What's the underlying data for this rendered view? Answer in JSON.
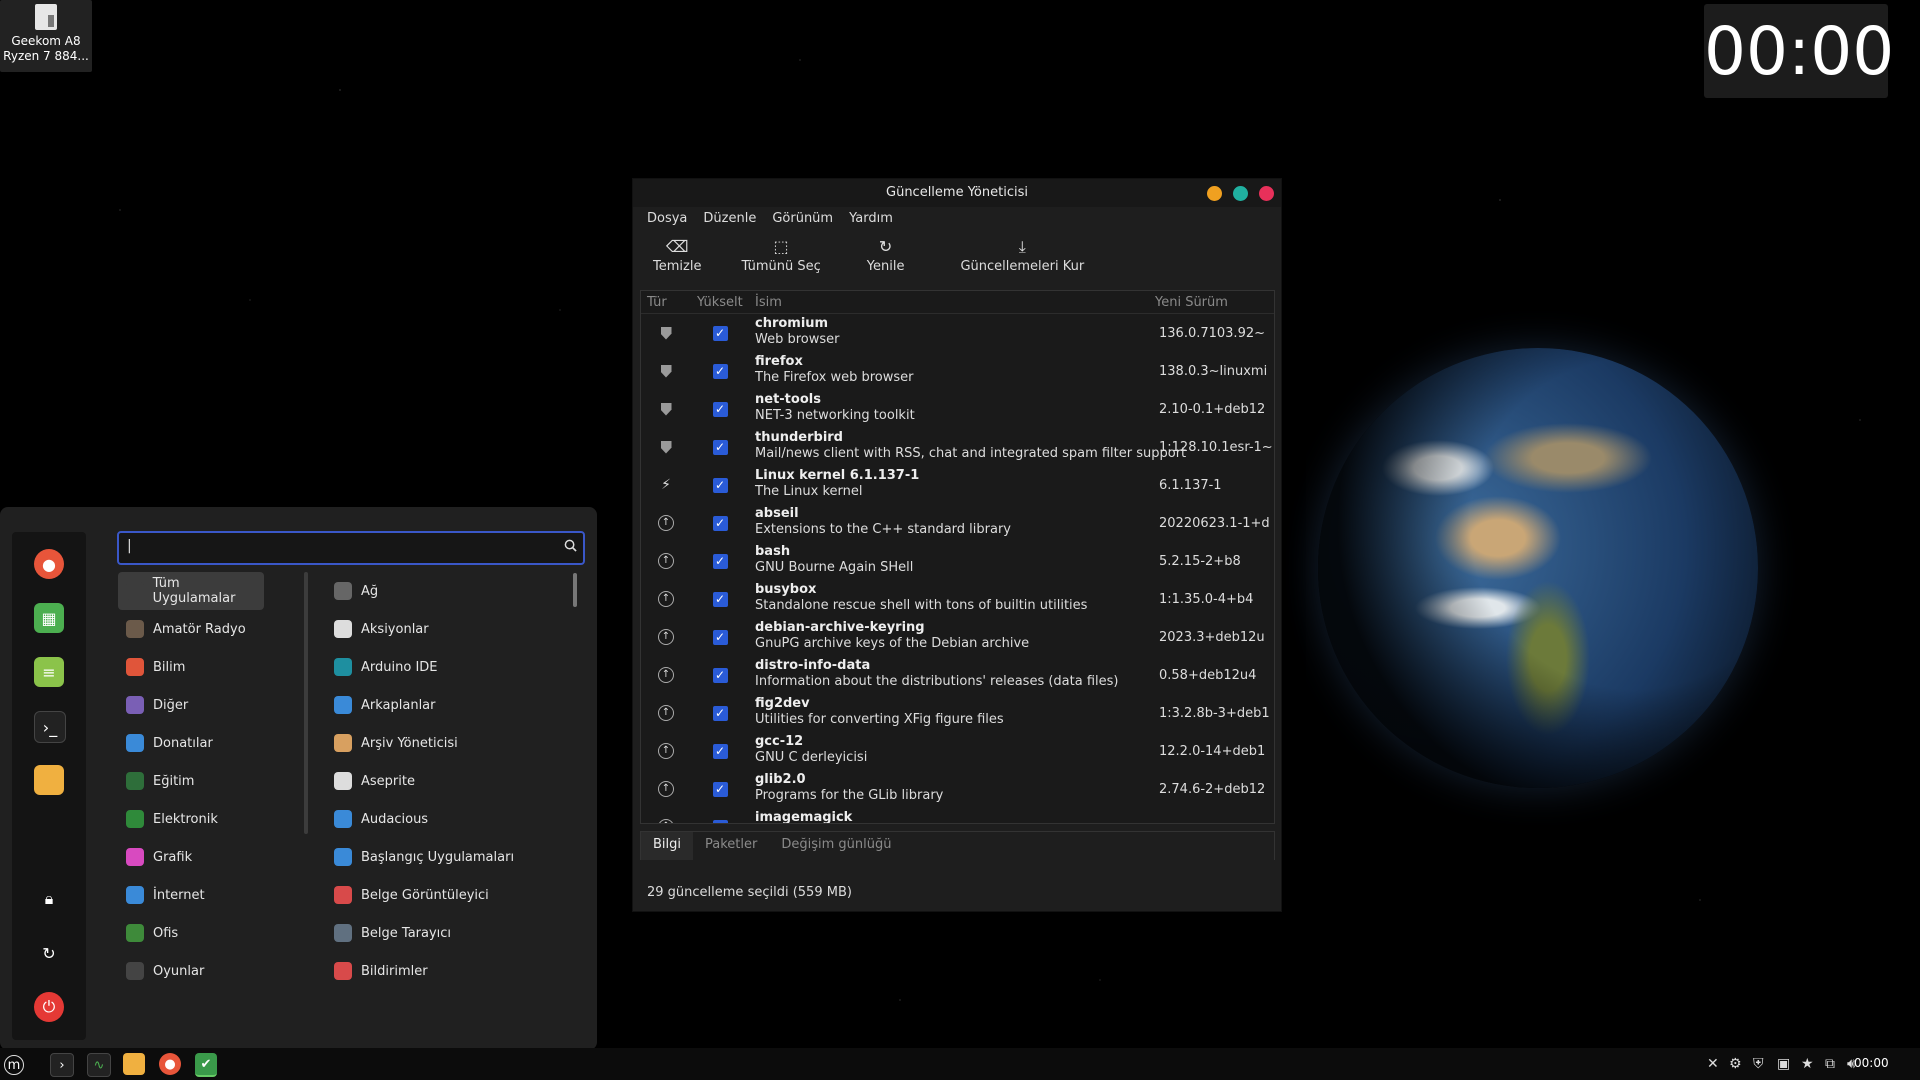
{
  "desktop": {
    "icon_label_line1": "Geekom A8",
    "icon_label_line2": "Ryzen 7 884...",
    "clock": "00:00"
  },
  "window": {
    "title": "Güncelleme Yöneticisi",
    "menu": [
      "Dosya",
      "Düzenle",
      "Görünüm",
      "Yardım"
    ],
    "toolbar": {
      "clear": "Temizle",
      "select_all": "Tümünü Seç",
      "refresh": "Yenile",
      "install": "Güncellemeleri Kur"
    },
    "columns": {
      "type": "Tür",
      "upgrade": "Yükselt",
      "name": "İsim",
      "new_version": "Yeni Sürüm"
    },
    "updates": [
      {
        "type": "security",
        "name": "chromium",
        "desc": "Web browser",
        "version": "136.0.7103.92~"
      },
      {
        "type": "security",
        "name": "firefox",
        "desc": "The Firefox web browser",
        "version": "138.0.3~linuxmi"
      },
      {
        "type": "security",
        "name": "net-tools",
        "desc": "NET-3 networking toolkit",
        "version": "2.10-0.1+deb12"
      },
      {
        "type": "security",
        "name": "thunderbird",
        "desc": "Mail/news client with RSS, chat and integrated spam filter support",
        "version": "1:128.10.1esr-1~"
      },
      {
        "type": "kernel",
        "name": "Linux kernel 6.1.137-1",
        "desc": "The Linux kernel",
        "version": "6.1.137-1"
      },
      {
        "type": "update",
        "name": "abseil",
        "desc": "Extensions to the C++ standard library",
        "version": "20220623.1-1+d"
      },
      {
        "type": "update",
        "name": "bash",
        "desc": "GNU Bourne Again SHell",
        "version": "5.2.15-2+b8"
      },
      {
        "type": "update",
        "name": "busybox",
        "desc": "Standalone rescue shell with tons of builtin utilities",
        "version": "1:1.35.0-4+b4"
      },
      {
        "type": "update",
        "name": "debian-archive-keyring",
        "desc": "GnuPG archive keys of the Debian archive",
        "version": "2023.3+deb12u"
      },
      {
        "type": "update",
        "name": "distro-info-data",
        "desc": "Information about the distributions' releases (data files)",
        "version": "0.58+deb12u4"
      },
      {
        "type": "update",
        "name": "fig2dev",
        "desc": "Utilities for converting XFig figure files",
        "version": "1:3.2.8b-3+deb1"
      },
      {
        "type": "update",
        "name": "gcc-12",
        "desc": "GNU C derleyicisi",
        "version": "12.2.0-14+deb1"
      },
      {
        "type": "update",
        "name": "glib2.0",
        "desc": "Programs for the GLib library",
        "version": "2.74.6-2+deb12"
      },
      {
        "type": "update",
        "name": "imagemagick",
        "desc": "",
        "version": ""
      }
    ],
    "tabs": [
      "Bilgi",
      "Paketler",
      "Değişim günlüğü"
    ],
    "status": "29 güncelleme seçildi (559 MB)"
  },
  "app_menu": {
    "search_value": "|",
    "categories": [
      {
        "label": "Tüm Uygulamalar",
        "icon": "grid-icon",
        "color": "#3c3c3c"
      },
      {
        "label": "Amatör Radyo",
        "icon": "radio-icon",
        "color": "#6b5a4a"
      },
      {
        "label": "Bilim",
        "icon": "science-icon",
        "color": "#e0553a"
      },
      {
        "label": "Diğer",
        "icon": "grid-icon",
        "color": "#7a5fb5"
      },
      {
        "label": "Donatılar",
        "icon": "scissors-icon",
        "color": "#3a8ad8"
      },
      {
        "label": "Eğitim",
        "icon": "education-icon",
        "color": "#2e6e3a"
      },
      {
        "label": "Elektronik",
        "icon": "chip-icon",
        "color": "#2f8a3a"
      },
      {
        "label": "Grafik",
        "icon": "palette-icon",
        "color": "#d84ac0"
      },
      {
        "label": "İnternet",
        "icon": "cloud-icon",
        "color": "#3a8ad8"
      },
      {
        "label": "Ofis",
        "icon": "office-icon",
        "color": "#3e8a3a"
      },
      {
        "label": "Oyunlar",
        "icon": "gamepad-icon",
        "color": "#444444"
      }
    ],
    "apps": [
      {
        "label": "Ağ",
        "icon": "wifi-icon",
        "color": "#666666"
      },
      {
        "label": "Aksiyonlar",
        "icon": "list-icon",
        "color": "#dddddd"
      },
      {
        "label": "Arduino IDE",
        "icon": "arduino-icon",
        "color": "#1e8fa0"
      },
      {
        "label": "Arkaplanlar",
        "icon": "wallpaper-icon",
        "color": "#3a8ad8"
      },
      {
        "label": "Arşiv Yöneticisi",
        "icon": "archive-icon",
        "color": "#d8a060"
      },
      {
        "label": "Aseprite",
        "icon": "aseprite-icon",
        "color": "#dddddd"
      },
      {
        "label": "Audacious",
        "icon": "audio-icon",
        "color": "#3a8ad8"
      },
      {
        "label": "Başlangıç Uygulamaları",
        "icon": "startup-icon",
        "color": "#3a8ad8"
      },
      {
        "label": "Belge Görüntüleyici",
        "icon": "viewer-icon",
        "color": "#d84a4a"
      },
      {
        "label": "Belge Tarayıcı",
        "icon": "scanner-icon",
        "color": "#607080"
      },
      {
        "label": "Bildirimler",
        "icon": "bell-icon",
        "color": "#d84a4a"
      }
    ]
  }
}
